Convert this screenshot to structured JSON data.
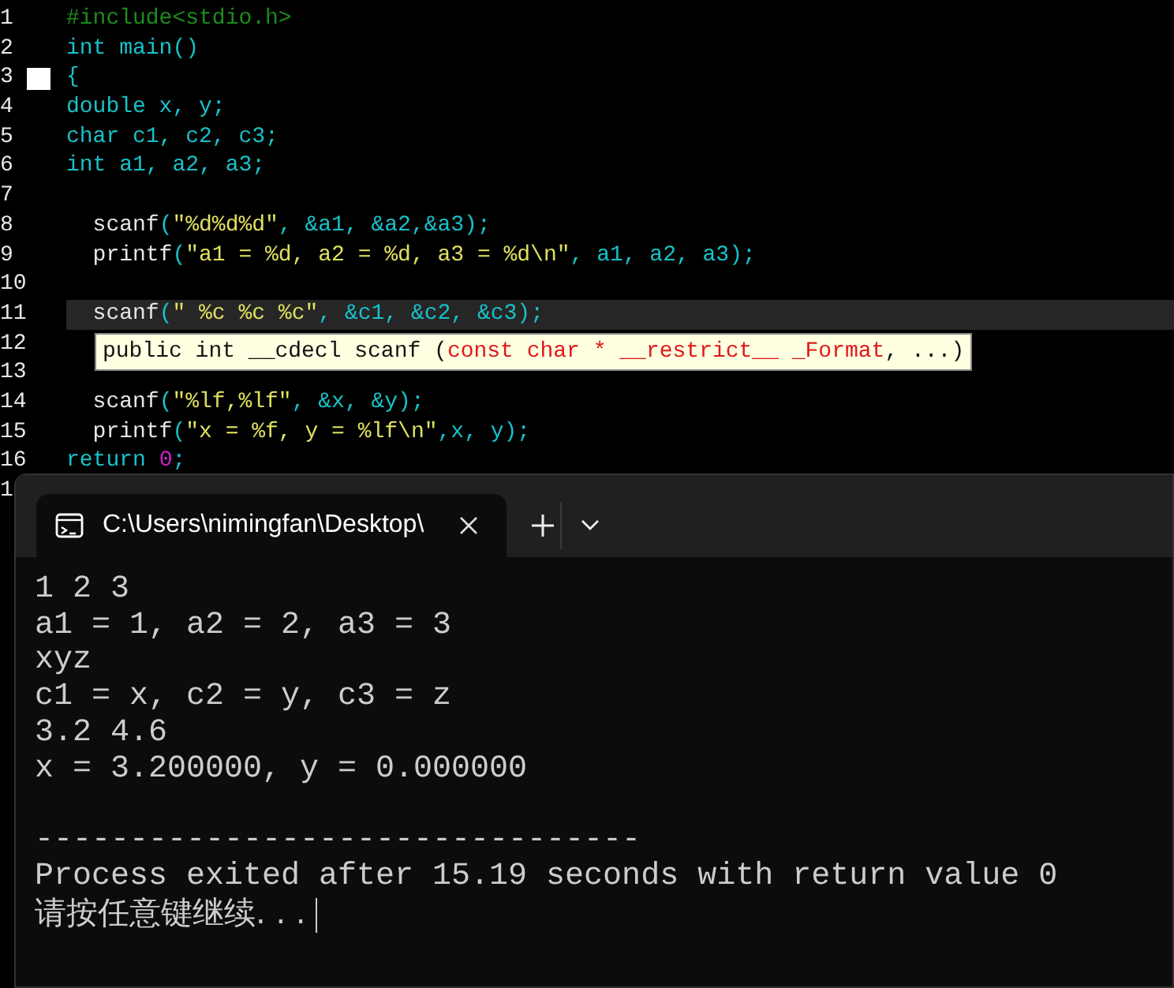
{
  "editor": {
    "lines": [
      {
        "number": "1",
        "current": false,
        "fold_start": false,
        "tokens": [
          {
            "text": "#include<stdio.h>",
            "kind": "pre"
          }
        ]
      },
      {
        "number": "2",
        "current": false,
        "fold_start": false,
        "tokens": [
          {
            "text": "int main()",
            "kind": "kw"
          }
        ]
      },
      {
        "number": "3",
        "current": false,
        "fold_start": true,
        "tokens": [
          {
            "text": "{",
            "kind": "kw"
          }
        ]
      },
      {
        "number": "4",
        "current": false,
        "fold_start": false,
        "tokens": [
          {
            "text": "double x, y;",
            "kind": "kw"
          }
        ]
      },
      {
        "number": "5",
        "current": false,
        "fold_start": false,
        "tokens": [
          {
            "text": "char c1, c2, c3;",
            "kind": "kw"
          }
        ]
      },
      {
        "number": "6",
        "current": false,
        "fold_start": false,
        "tokens": [
          {
            "text": "int a1, a2, a3;",
            "kind": "kw"
          }
        ]
      },
      {
        "number": "7",
        "current": false,
        "fold_start": false
      },
      {
        "number": "8",
        "current": false,
        "fold_start": false,
        "tokens": [
          {
            "text": "  scanf",
            "kind": "fn"
          },
          {
            "text": "(",
            "kind": "kw"
          },
          {
            "text": "\"%d%d%d\"",
            "kind": "str"
          },
          {
            "text": ", &a1, &a2,&a3);",
            "kind": "kw"
          }
        ]
      },
      {
        "number": "9",
        "current": false,
        "fold_start": false,
        "tokens": [
          {
            "text": "  printf",
            "kind": "fn"
          },
          {
            "text": "(",
            "kind": "kw"
          },
          {
            "text": "\"a1 = %d, a2 = %d, a3 = %d\\n\"",
            "kind": "str"
          },
          {
            "text": ", a1, a2, a3);",
            "kind": "kw"
          }
        ]
      },
      {
        "number": "10",
        "current": false,
        "fold_start": false
      },
      {
        "number": "11",
        "current": true,
        "fold_start": false,
        "tokens": [
          {
            "text": "  scanf",
            "kind": "fn"
          },
          {
            "text": "(",
            "kind": "kw"
          },
          {
            "text": "\" %c %c %c\"",
            "kind": "str"
          },
          {
            "text": ", &c1, &c2, &c3);",
            "kind": "kw"
          }
        ]
      },
      {
        "number": "12",
        "current": false,
        "fold_start": false
      },
      {
        "number": "13",
        "current": false,
        "fold_start": false
      },
      {
        "number": "14",
        "current": false,
        "fold_start": false,
        "tokens": [
          {
            "text": "  scanf",
            "kind": "fn"
          },
          {
            "text": "(",
            "kind": "kw"
          },
          {
            "text": "\"%lf,%lf\"",
            "kind": "str"
          },
          {
            "text": ", &x, &y);",
            "kind": "kw"
          }
        ]
      },
      {
        "number": "15",
        "current": false,
        "fold_start": false,
        "tokens": [
          {
            "text": "  printf",
            "kind": "fn"
          },
          {
            "text": "(",
            "kind": "kw"
          },
          {
            "text": "\"x = %f, y = %lf\\n\"",
            "kind": "str"
          },
          {
            "text": ",x, y);",
            "kind": "kw"
          }
        ]
      },
      {
        "number": "16",
        "current": false,
        "fold_start": false,
        "tokens": [
          {
            "text": "return ",
            "kind": "kw"
          },
          {
            "text": "0",
            "kind": "num"
          },
          {
            "text": ";",
            "kind": "kw"
          }
        ]
      },
      {
        "number": "1",
        "current": false,
        "fold_start": false
      }
    ],
    "tooltip": [
      {
        "text": "public int __cdecl scanf (",
        "kind": "plain"
      },
      {
        "text": "const char * __restrict__ _Format",
        "kind": "param"
      },
      {
        "text": ", ...)",
        "kind": "plain"
      }
    ]
  },
  "terminal": {
    "tab_title": "C:\\Users\\nimingfan\\Desktop\\",
    "cursor": true,
    "output": [
      {
        "text": "1 2 3",
        "kind": "text"
      },
      {
        "text": "a1 = 1, a2 = 2, a3 = 3",
        "kind": "text"
      },
      {
        "text": "xyz",
        "kind": "text"
      },
      {
        "text": "c1 = x, c2 = y, c3 = z",
        "kind": "text"
      },
      {
        "text": "3.2 4.6",
        "kind": "text"
      },
      {
        "text": "x = 3.200000, y = 0.000000",
        "kind": "text"
      },
      {
        "text": "--------------------------------",
        "kind": "rule"
      },
      {
        "text": "Process exited after 15.19 seconds with return value 0",
        "kind": "text"
      },
      {
        "text": "请按任意键继续. . .",
        "kind": "prompt"
      }
    ]
  }
}
